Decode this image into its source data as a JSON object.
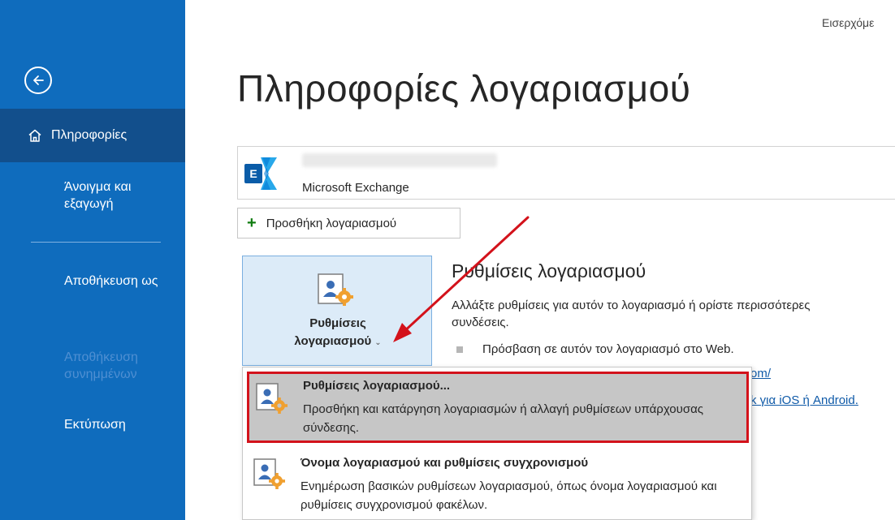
{
  "sidebar": {
    "nav_info_label": "Πληροφορίες",
    "open_export_label": "Άνοιγμα και εξαγωγή",
    "save_as_label": "Αποθήκευση ως",
    "save_attachments_label": "Αποθήκευση συνημμένων",
    "print_label": "Εκτύπωση"
  },
  "header": {
    "inbox_crumb": "Εισερχόμε"
  },
  "page": {
    "title": "Πληροφορίες λογαριασμού"
  },
  "account": {
    "type": "Microsoft Exchange",
    "add_account_label": "Προσθήκη λογαριασμού"
  },
  "account_settings": {
    "tile_label_line1": "Ρυθμίσεις",
    "tile_label_line2": "λογαριασμού",
    "section_title": "Ρυθμίσεις λογαριασμού",
    "section_desc": "Αλλάξτε ρυθμίσεις για αυτόν το λογαριασμό ή ορίστε περισσότερες συνδέσεις.",
    "bullet_text": "Πρόσβαση σε αυτόν τον λογαριασμό στο Web.",
    "link_fragment_1": "om/",
    "link_fragment_2": "k για iOS ή Android."
  },
  "dropdown": {
    "items": [
      {
        "title": "Ρυθμίσεις λογαριασμού...",
        "desc": "Προσθήκη και κατάργηση λογαριασμών ή αλλαγή ρυθμίσεων υπάρχουσας σύνδεσης."
      },
      {
        "title": "Όνομα λογαριασμού και ρυθμίσεις συγχρονισμού",
        "desc": "Ενημέρωση βασικών ρυθμίσεων λογαριασμού, όπως όνομα λογαριασμού και ρυθμίσεις συγχρονισμού φακέλων."
      }
    ]
  },
  "icons": {
    "back": "back-arrow-icon",
    "home": "home-icon",
    "exchange": "exchange-logo-icon",
    "add": "plus-icon",
    "account_settings": "account-settings-icon",
    "chevron": "chevron-down-icon"
  },
  "colors": {
    "sidebar_bg": "#0f6cbd",
    "sidebar_selected": "#124f8c",
    "tile_bg": "#dcebf8",
    "highlight_border": "#d3121b",
    "link": "#0f5aa8",
    "plus": "#107c10"
  }
}
